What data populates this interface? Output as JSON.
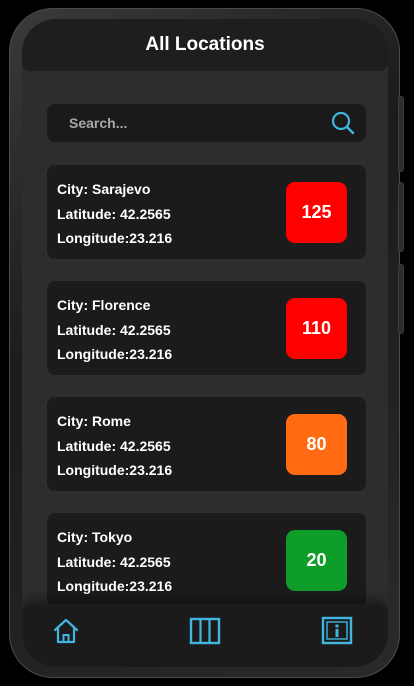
{
  "header": {
    "title": "All Locations"
  },
  "search": {
    "placeholder": "Search...",
    "value": ""
  },
  "locations": [
    {
      "city": "City: Sarajevo",
      "latitude": "Latitude: 42.2565",
      "longitude": "Longitude:23.216",
      "value": "125",
      "color": "#ff0000"
    },
    {
      "city": "City: Florence",
      "latitude": "Latitude: 42.2565",
      "longitude": "Longitude:23.216",
      "value": "110",
      "color": "#ff0000"
    },
    {
      "city": "City: Rome",
      "latitude": "Latitude: 42.2565",
      "longitude": "Longitude:23.216",
      "value": "80",
      "color": "#ff6a13"
    },
    {
      "city": "City: Tokyo",
      "latitude": "Latitude: 42.2565",
      "longitude": "Longitude:23.216",
      "value": "20",
      "color": "#0f9d2a"
    }
  ],
  "nav": {
    "items": [
      {
        "icon": "home-icon"
      },
      {
        "icon": "map-icon"
      },
      {
        "icon": "info-icon"
      }
    ],
    "accent": "#3fb6e0"
  },
  "theme": {
    "screen_bg": "#2d2d2d",
    "card_bg": "#1b1b1b"
  }
}
